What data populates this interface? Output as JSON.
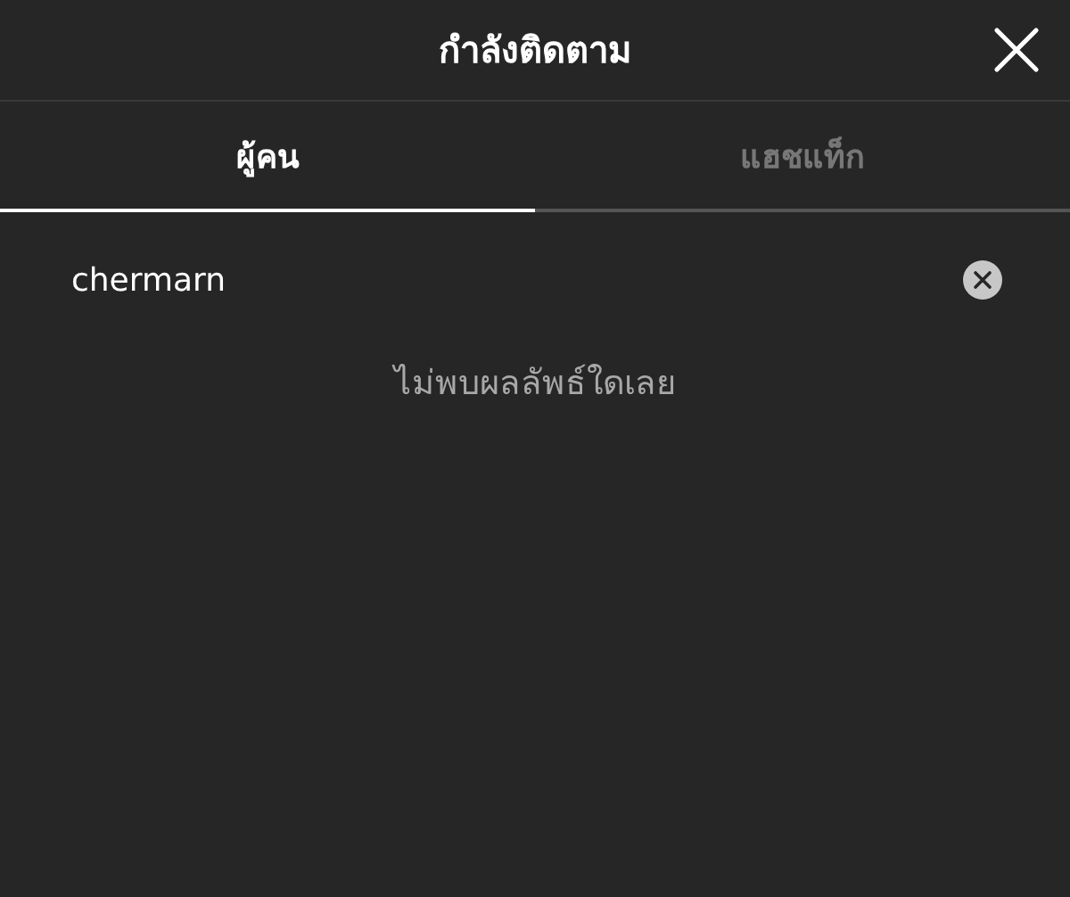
{
  "header": {
    "title": "กำลังติดตาม"
  },
  "tabs": [
    {
      "label": "ผู้คน",
      "selected": true
    },
    {
      "label": "แฮชแท็ก",
      "selected": false
    }
  ],
  "search": {
    "value": "chermarn"
  },
  "empty_message": "ไม่พบผลลัพธ์ใดเลย"
}
